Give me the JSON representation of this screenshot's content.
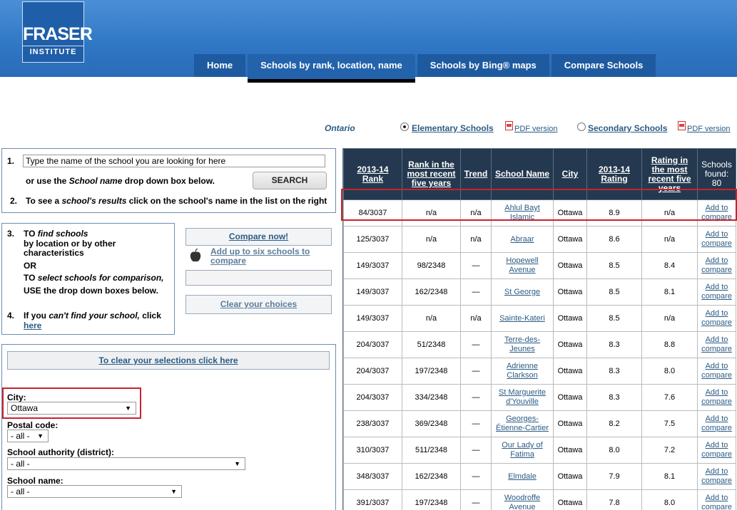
{
  "header": {
    "logo_line1": "FRASER",
    "logo_line2": "INSTITUTE",
    "nav": [
      "Home",
      "Schools by rank, location, name",
      "Schools by Bing® maps",
      "Compare Schools"
    ]
  },
  "type_row": {
    "province": "Ontario",
    "elementary": "Elementary Schools",
    "secondary": "Secondary Schools",
    "pdf": "PDF version"
  },
  "search": {
    "step1_num": "1.",
    "input_value": "Type the name of the school you are looking for here",
    "or_prefix": "or use the",
    "or_italic": "School name",
    "or_suffix": "drop down box below.",
    "button": "SEARCH",
    "step2_num": "2.",
    "step2_a": "To see a",
    "step2_italic": "school's results",
    "step2_b": "click on the school's name in the list on the right"
  },
  "steps": {
    "s3_num": "3.",
    "s3_l1a": "TO",
    "s3_l1i": "find schools",
    "s3_l2": "by location or by other",
    "s3_l3": "characteristics",
    "s3_l4": "OR",
    "s3_l5a": "TO",
    "s3_l5i": "select schools for comparison,",
    "s3_l6": "USE the drop down boxes below.",
    "s4_num": "4.",
    "s4_a": "If you",
    "s4_i": "can't find your school,",
    "s4_b": "click",
    "s4_link": "here"
  },
  "compare": {
    "now": "Compare now!",
    "add_l1": "Add up to six schools to",
    "add_l2": "compare",
    "clear": "Clear your choices"
  },
  "filters": {
    "clear_selections": "To clear your selections click here",
    "city_label": "City:",
    "city_value": "Ottawa",
    "postal_label": "Postal code:",
    "postal_value": "- all -",
    "authority_label": "School authority (district):",
    "authority_value": "- all -",
    "school_label": "School name:",
    "school_value": "- all -"
  },
  "table": {
    "headers": {
      "rank": [
        "2013-14",
        "Rank"
      ],
      "rank5": [
        "Rank in the",
        "most recent",
        "five years"
      ],
      "trend": "Trend",
      "name": "School Name",
      "city": "City",
      "rating": [
        "2013-14",
        "Rating"
      ],
      "rating5": [
        "Rating in",
        "the most",
        "recent five",
        "years"
      ],
      "found": [
        "Schools",
        "found:",
        "80"
      ]
    },
    "compare_label": [
      "Add to",
      "compare"
    ],
    "rows": [
      {
        "rank": "84/3037",
        "rank5": "n/a",
        "trend": "n/a",
        "name": [
          "Ahlul Bayt",
          "Islamic"
        ],
        "city": "Ottawa",
        "rating": "8.9",
        "rating5": "n/a"
      },
      {
        "rank": "125/3037",
        "rank5": "n/a",
        "trend": "n/a",
        "name": [
          "Abraar"
        ],
        "city": "Ottawa",
        "rating": "8.6",
        "rating5": "n/a"
      },
      {
        "rank": "149/3037",
        "rank5": "98/2348",
        "trend": "—",
        "name": [
          "Hopewell",
          "Avenue"
        ],
        "city": "Ottawa",
        "rating": "8.5",
        "rating5": "8.4"
      },
      {
        "rank": "149/3037",
        "rank5": "162/2348",
        "trend": "—",
        "name": [
          "St George"
        ],
        "city": "Ottawa",
        "rating": "8.5",
        "rating5": "8.1"
      },
      {
        "rank": "149/3037",
        "rank5": "n/a",
        "trend": "n/a",
        "name": [
          "Sainte-Kateri"
        ],
        "city": "Ottawa",
        "rating": "8.5",
        "rating5": "n/a"
      },
      {
        "rank": "204/3037",
        "rank5": "51/2348",
        "trend": "—",
        "name": [
          "Terre-des-",
          "Jeunes"
        ],
        "city": "Ottawa",
        "rating": "8.3",
        "rating5": "8.8"
      },
      {
        "rank": "204/3037",
        "rank5": "197/2348",
        "trend": "—",
        "name": [
          "Adrienne",
          "Clarkson"
        ],
        "city": "Ottawa",
        "rating": "8.3",
        "rating5": "8.0"
      },
      {
        "rank": "204/3037",
        "rank5": "334/2348",
        "trend": "—",
        "name": [
          "St Marguerite",
          "d'Youville"
        ],
        "city": "Ottawa",
        "rating": "8.3",
        "rating5": "7.6"
      },
      {
        "rank": "238/3037",
        "rank5": "369/2348",
        "trend": "—",
        "name": [
          "Georges-",
          "Étienne-Cartier"
        ],
        "city": "Ottawa",
        "rating": "8.2",
        "rating5": "7.5"
      },
      {
        "rank": "310/3037",
        "rank5": "511/2348",
        "trend": "—",
        "name": [
          "Our Lady of",
          "Fatima"
        ],
        "city": "Ottawa",
        "rating": "8.0",
        "rating5": "7.2"
      },
      {
        "rank": "348/3037",
        "rank5": "162/2348",
        "trend": "—",
        "name": [
          "Elmdale"
        ],
        "city": "Ottawa",
        "rating": "7.9",
        "rating5": "8.1"
      },
      {
        "rank": "391/3037",
        "rank5": "197/2348",
        "trend": "—",
        "name": [
          "Woodroffe",
          "Avenue"
        ],
        "city": "Ottawa",
        "rating": "7.8",
        "rating5": "8.0"
      }
    ]
  },
  "colors": {
    "header_blue": "#2f76c4",
    "nav_bg": "#1e5aa0",
    "table_header": "#24394f",
    "link": "#2b5b85",
    "highlight": "#c8232c"
  }
}
